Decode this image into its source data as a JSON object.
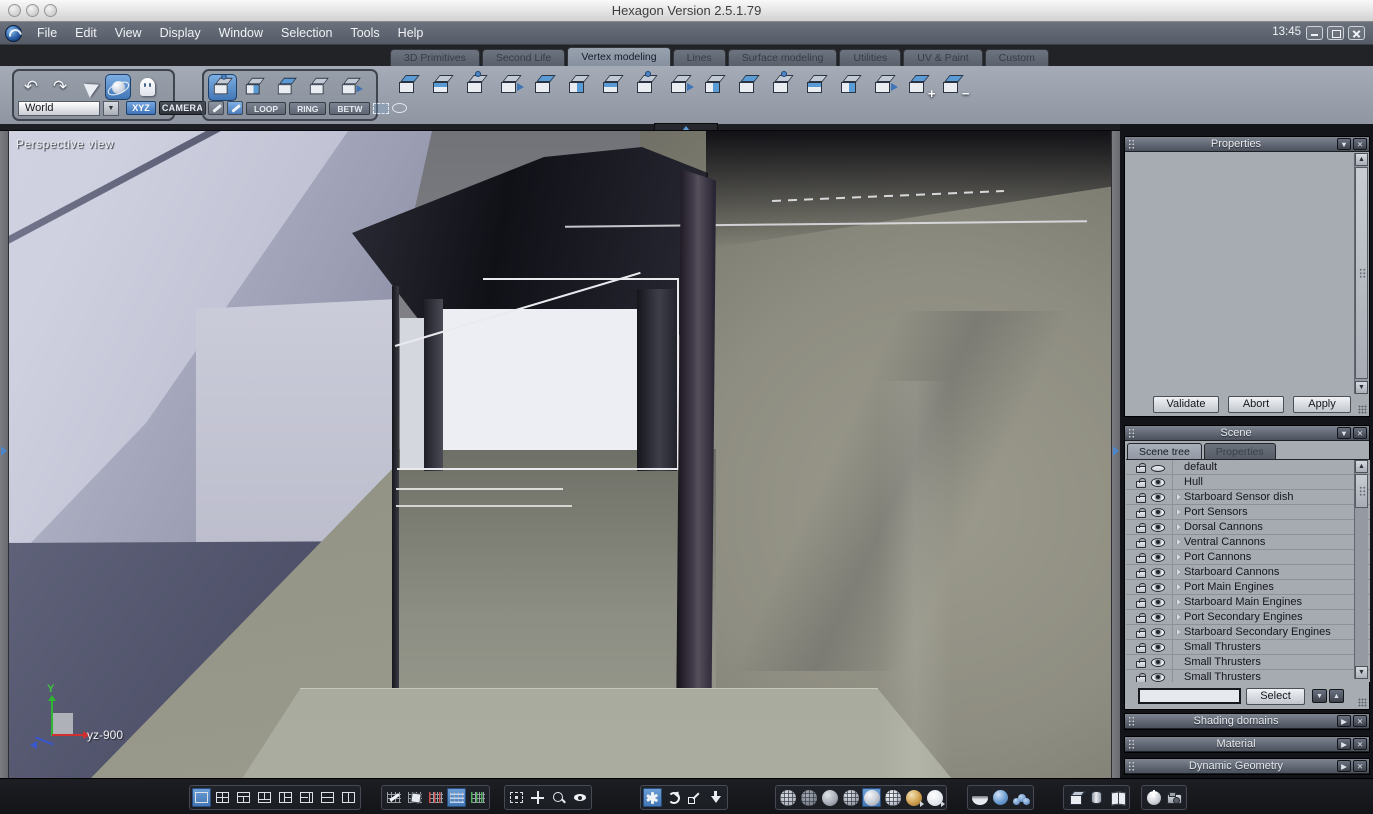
{
  "window": {
    "title": "Hexagon Version 2.5.1.79",
    "clock": "13:45",
    "traffic_lights": [
      {
        "name": "mac-close-button"
      },
      {
        "name": "mac-minimize-button"
      },
      {
        "name": "mac-zoom-button"
      }
    ],
    "controls": [
      {
        "name": "minimize-button",
        "cls": "wmin"
      },
      {
        "name": "maximize-button",
        "cls": "wmax"
      },
      {
        "name": "close-button",
        "cls": "wclose"
      }
    ]
  },
  "menubar": {
    "items": [
      {
        "name": "menu-file",
        "label": "File"
      },
      {
        "name": "menu-edit",
        "label": "Edit"
      },
      {
        "name": "menu-view",
        "label": "View"
      },
      {
        "name": "menu-display",
        "label": "Display"
      },
      {
        "name": "menu-window",
        "label": "Window"
      },
      {
        "name": "menu-selection",
        "label": "Selection"
      },
      {
        "name": "menu-tools",
        "label": "Tools"
      },
      {
        "name": "menu-help",
        "label": "Help"
      }
    ]
  },
  "ribbon_tabs": [
    {
      "name": "tab-3d-primitives",
      "label": "3D Primitives",
      "active": false
    },
    {
      "name": "tab-second-life",
      "label": "Second Life",
      "active": false
    },
    {
      "name": "tab-vertex-modeling",
      "label": "Vertex modeling",
      "active": true
    },
    {
      "name": "tab-lines",
      "label": "Lines",
      "active": false
    },
    {
      "name": "tab-surface-modeling",
      "label": "Surface modeling",
      "active": false
    },
    {
      "name": "tab-utilities",
      "label": "Utilities",
      "active": false
    },
    {
      "name": "tab-uv-paint",
      "label": "UV & Paint",
      "active": false
    },
    {
      "name": "tab-custom",
      "label": "Custom",
      "active": false
    }
  ],
  "toolbox": {
    "history": {
      "undo_glyph": "↶",
      "redo_glyph": "↷",
      "world_selector": {
        "value": "World"
      },
      "xyz_label": "XYZ",
      "camera_label": "CAMERA"
    },
    "selection": {
      "cubes": [
        {
          "name": "select-vertices-button",
          "cls": "t-c",
          "sel": true
        },
        {
          "name": "select-edges-button",
          "cls": "t-e",
          "sel": false
        },
        {
          "name": "select-faces-button",
          "cls": "t-a",
          "sel": false
        },
        {
          "name": "select-object-button",
          "cls": "",
          "sel": false
        },
        {
          "name": "select-auto-button",
          "cls": "t-d",
          "sel": false
        }
      ],
      "loop_label": "LOOP",
      "ring_label": "RING",
      "betw_label": "BETW"
    },
    "tools": [
      {
        "name": "bevel-tool-button",
        "cls": "t-a",
        "overlay": ""
      },
      {
        "name": "extract-around-tool-button",
        "cls": "t-b",
        "overlay": ""
      },
      {
        "name": "extract-along-tool-button",
        "cls": "t-c",
        "overlay": ""
      },
      {
        "name": "fast-extrude-tool-button",
        "cls": "t-d",
        "overlay": ""
      },
      {
        "name": "extrude-surface-tool-button",
        "cls": "t-a",
        "overlay": ""
      },
      {
        "name": "thickness-tool-button",
        "cls": "t-e",
        "overlay": ""
      },
      {
        "name": "sweep-surface-tool-button",
        "cls": "t-b",
        "overlay": ""
      },
      {
        "name": "smooth-tool-button",
        "cls": "t-c",
        "overlay": ""
      },
      {
        "name": "bridge-tool-button",
        "cls": "t-d",
        "overlay": ""
      },
      {
        "name": "tessellate-tool-button",
        "cls": "t-e",
        "overlay": ""
      },
      {
        "name": "weld-tool-button",
        "cls": "t-a",
        "overlay": ""
      },
      {
        "name": "symmetry-tool-button",
        "cls": "t-c",
        "overlay": ""
      },
      {
        "name": "stretch-tool-button",
        "cls": "t-b",
        "overlay": ""
      },
      {
        "name": "taper-tool-button",
        "cls": "t-e",
        "overlay": ""
      },
      {
        "name": "twist-tool-button",
        "cls": "t-d",
        "overlay": ""
      },
      {
        "name": "smoothing-increase-tool-button",
        "cls": "t-a",
        "overlay": "+"
      },
      {
        "name": "smoothing-decrease-tool-button",
        "cls": "t-a",
        "overlay": "−"
      }
    ]
  },
  "viewport": {
    "label": "Perspective view",
    "axis_gizmo": {
      "y_label": "Y",
      "caption": "yz-900"
    }
  },
  "right_panels": {
    "properties": {
      "title": "Properties",
      "validate_label": "Validate",
      "abort_label": "Abort",
      "apply_label": "Apply"
    },
    "scene": {
      "title": "Scene",
      "tabs": [
        {
          "name": "scene-tree-tab",
          "label": "Scene tree",
          "active": true
        },
        {
          "name": "scene-properties-tab",
          "label": "Properties",
          "active": false
        }
      ],
      "tree": [
        {
          "label": "default",
          "arrow_cls": "hidden",
          "eye_cls": "closed"
        },
        {
          "label": "Hull",
          "arrow_cls": "hidden",
          "eye_cls": ""
        },
        {
          "label": "Starboard Sensor dish",
          "arrow_cls": "",
          "eye_cls": ""
        },
        {
          "label": "Port Sensors",
          "arrow_cls": "",
          "eye_cls": ""
        },
        {
          "label": "Dorsal Cannons",
          "arrow_cls": "",
          "eye_cls": ""
        },
        {
          "label": "Ventral Cannons",
          "arrow_cls": "",
          "eye_cls": ""
        },
        {
          "label": "Port Cannons",
          "arrow_cls": "",
          "eye_cls": ""
        },
        {
          "label": "Starboard Cannons",
          "arrow_cls": "",
          "eye_cls": ""
        },
        {
          "label": "Port Main Engines",
          "arrow_cls": "",
          "eye_cls": ""
        },
        {
          "label": "Starboard Main Engines",
          "arrow_cls": "",
          "eye_cls": ""
        },
        {
          "label": "Port Secondary Engines",
          "arrow_cls": "",
          "eye_cls": ""
        },
        {
          "label": "Starboard Secondary Engines",
          "arrow_cls": "",
          "eye_cls": ""
        },
        {
          "label": "Small Thrusters",
          "arrow_cls": "hidden",
          "eye_cls": ""
        },
        {
          "label": "Small Thrusters",
          "arrow_cls": "hidden",
          "eye_cls": ""
        },
        {
          "label": "Small Thrusters",
          "arrow_cls": "hidden",
          "eye_cls": ""
        }
      ],
      "select_label": "Select",
      "filter_value": ""
    },
    "collapsed": {
      "shading_title": "Shading domains",
      "material_title": "Material",
      "dynamic_title": "Dynamic Geometry"
    }
  },
  "bottombar": {
    "groups": [
      {
        "items": [
          {
            "name": "layout-single-button",
            "cls": "lay l-single",
            "sel": true
          },
          {
            "name": "layout-quad-button",
            "cls": "lay l-quad",
            "sel": false
          },
          {
            "name": "layout-wide-top-button",
            "cls": "lay l-top",
            "sel": false
          },
          {
            "name": "layout-wide-bottom-button",
            "cls": "lay l-bottom",
            "sel": false
          },
          {
            "name": "layout-left-column-button",
            "cls": "lay l-left",
            "sel": false
          },
          {
            "name": "layout-right-column-button",
            "cls": "lay l-right",
            "sel": false
          },
          {
            "name": "layout-two-rows-button",
            "cls": "lay l-rows",
            "sel": false
          },
          {
            "name": "layout-two-columns-button",
            "cls": "lay l-cols",
            "sel": false
          }
        ]
      },
      {
        "items": [
          {
            "name": "grid-edit-button",
            "cls": "grd g-pencil",
            "sel": false
          },
          {
            "name": "grid-snap-object-button",
            "cls": "grd g-obj",
            "sel": false
          },
          {
            "name": "grid-x-plane-button",
            "cls": "grd g-red",
            "sel": false
          },
          {
            "name": "grid-y-plane-button",
            "cls": "grd g-blue",
            "sel": true
          },
          {
            "name": "grid-z-plane-button",
            "cls": "grd g-green",
            "sel": false
          }
        ]
      },
      {
        "items": [
          {
            "name": "fit-view-button",
            "cls": "fitb",
            "sel": false
          },
          {
            "name": "pan-view-button",
            "cls": "panb",
            "sel": false
          },
          {
            "name": "zoom-region-button",
            "cls": "zoomb",
            "sel": false
          },
          {
            "name": "look-at-button",
            "cls": "eyeb",
            "sel": false
          }
        ]
      },
      {
        "items": [
          {
            "name": "universal-manipulator-button",
            "cls": "manu",
            "sel": true
          },
          {
            "name": "rotate-manipulator-button",
            "cls": "manr",
            "sel": false
          },
          {
            "name": "scale-manipulator-button",
            "cls": "mans",
            "sel": false
          },
          {
            "name": "drop-object-button",
            "cls": "mand",
            "sel": false
          }
        ]
      },
      {
        "items": [
          {
            "name": "wireframe-shading-button",
            "cls": "sph s-wire",
            "sel": false
          },
          {
            "name": "hidden-line-shading-button",
            "cls": "sph s-wire2",
            "sel": false
          },
          {
            "name": "flat-shading-button",
            "cls": "sph s-flat",
            "sel": false
          },
          {
            "name": "flat-wire-shading-button",
            "cls": "sph s-flatw",
            "sel": false
          },
          {
            "name": "smooth-shading-button",
            "cls": "sph s-smooth",
            "sel": true
          },
          {
            "name": "smooth-wire-shading-button",
            "cls": "sph s-smoothw",
            "sel": false
          },
          {
            "name": "textured-shading-button",
            "cls": "sph s-gold fly",
            "sel": false
          },
          {
            "name": "ghost-shading-button",
            "cls": "sph s-ghost fly",
            "sel": false
          }
        ]
      },
      {
        "items": [
          {
            "name": "low-smoothing-button",
            "cls": "hemib",
            "sel": false
          },
          {
            "name": "high-smoothing-button",
            "cls": "sphblue",
            "sel": false
          },
          {
            "name": "smoothing-range-button",
            "cls": "cluster",
            "sel": false
          }
        ]
      },
      {
        "items": [
          {
            "name": "bounding-box-button",
            "cls": "cubeb",
            "sel": false
          },
          {
            "name": "unfold-surface-button",
            "cls": "cylb",
            "sel": false
          },
          {
            "name": "reference-pages-button",
            "cls": "bookb",
            "sel": false
          }
        ]
      },
      {
        "items": [
          {
            "name": "render-light-button",
            "cls": "lightb",
            "sel": false
          },
          {
            "name": "snapshot-camera-button",
            "cls": "camb",
            "sel": false
          }
        ]
      }
    ]
  },
  "colors": {
    "accent_blue": "#4d86c8",
    "selection_blue": "#5b9bd5",
    "axis_red": "#d03030",
    "axis_green": "#2fb52f",
    "axis_blue": "#3858d0"
  }
}
